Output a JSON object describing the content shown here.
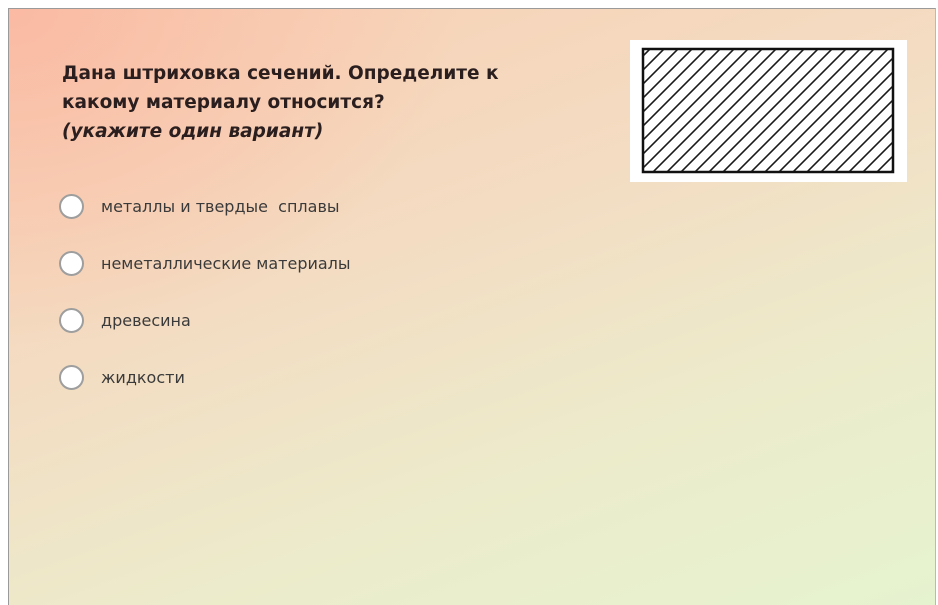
{
  "question": {
    "line1": "Дана штриховка сечений. Определите к",
    "line2": "какому материалу относится?",
    "hint": "(укажите один вариант)"
  },
  "options": [
    {
      "label": "металлы и твердые  сплавы",
      "selected": false
    },
    {
      "label": "неметаллические материалы",
      "selected": false
    },
    {
      "label": "древесина",
      "selected": false
    },
    {
      "label": "жидкости",
      "selected": false
    }
  ],
  "image": {
    "icon": "section-hatching-image",
    "hatch": "diagonal-lines"
  }
}
